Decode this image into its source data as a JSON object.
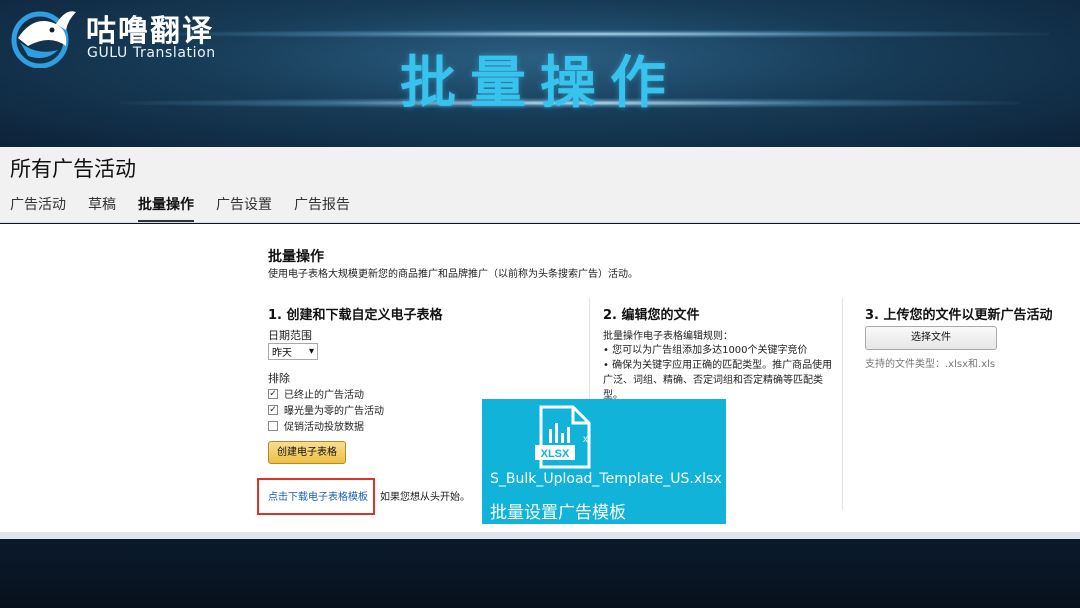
{
  "banner": {
    "brand_cn": "咕噜翻译",
    "brand_en": "GULU Translation",
    "title": "批量操作"
  },
  "header": {
    "page_title": "所有广告活动",
    "tabs": [
      {
        "label": "广告活动",
        "active": false
      },
      {
        "label": "草稿",
        "active": false
      },
      {
        "label": "批量操作",
        "active": true
      },
      {
        "label": "广告设置",
        "active": false
      },
      {
        "label": "广告报告",
        "active": false
      }
    ]
  },
  "bulk": {
    "title": "批量操作",
    "description": "使用电子表格大规模更新您的商品推广和品牌推广（以前称为头条搜索广告）活动。"
  },
  "step1": {
    "heading": "1. 创建和下载自定义电子表格",
    "date_range_label": "日期范围",
    "date_range_value": "昨天",
    "exclude_label": "排除",
    "checkboxes": [
      {
        "label": "已终止的广告活动",
        "checked": true
      },
      {
        "label": "曝光量为零的广告活动",
        "checked": true
      },
      {
        "label": "促销活动投放数据",
        "checked": false
      }
    ],
    "create_button": "创建电子表格",
    "download_link": "点击下载电子表格模板",
    "download_suffix": "如果您想从头开始。"
  },
  "step2": {
    "heading": "2. 编辑您的文件",
    "rules_title": "批量操作电子表格编辑规则：",
    "rules": [
      "• 您可以为广告组添加多达1000个关键字竞价",
      "• 确保为关键字应用正确的匹配类型。推广商品使用",
      "广泛、词组、精确、否定词组和否定精确等匹配类",
      "型。"
    ]
  },
  "step3": {
    "heading": "3. 上传您的文件以更新广告活动",
    "choose_file_button": "选择文件",
    "file_types": "支持的文件类型：.xlsx和.xls"
  },
  "overlay": {
    "icon": "xlsx-file-icon",
    "icon_text": "XLSX",
    "file_name": "S_Bulk_Upload_Template_US.xlsx",
    "caption": "批量设置广告模板"
  },
  "colors": {
    "banner_title": "#37c3ee",
    "overlay_bg": "#12b3d8",
    "link": "#1a5fb4",
    "highlight_box": "#d9342b",
    "button_yellow": "#efc042"
  }
}
